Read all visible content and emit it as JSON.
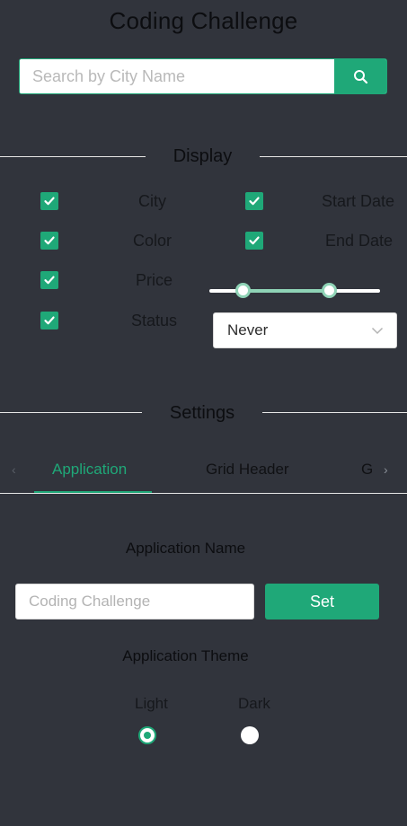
{
  "app": {
    "title": "Coding Challenge"
  },
  "search": {
    "placeholder": "Search by City Name",
    "value": ""
  },
  "display": {
    "title": "Display",
    "columns": [
      {
        "label": "City",
        "checked": true
      },
      {
        "label": "Start Date",
        "checked": true
      },
      {
        "label": "Color",
        "checked": true
      },
      {
        "label": "End Date",
        "checked": true
      },
      {
        "label": "Price",
        "checked": true
      },
      {
        "label": "Status",
        "checked": true
      }
    ],
    "price_range": {
      "low_fraction": 0.2,
      "high_fraction": 0.7
    },
    "status_select": {
      "value": "Never"
    }
  },
  "settings": {
    "title": "Settings",
    "tabs": [
      {
        "label": "Application",
        "active": true
      },
      {
        "label": "Grid Header",
        "active": false
      },
      {
        "label": "G",
        "active": false
      }
    ]
  },
  "application": {
    "name_label": "Application Name",
    "name_placeholder": "Coding Challenge",
    "set_label": "Set",
    "theme_label": "Application Theme",
    "themes": [
      {
        "label": "Light",
        "selected": true
      },
      {
        "label": "Dark",
        "selected": false
      }
    ]
  },
  "colors": {
    "accent": "#1fa878",
    "background": "#31343c"
  }
}
